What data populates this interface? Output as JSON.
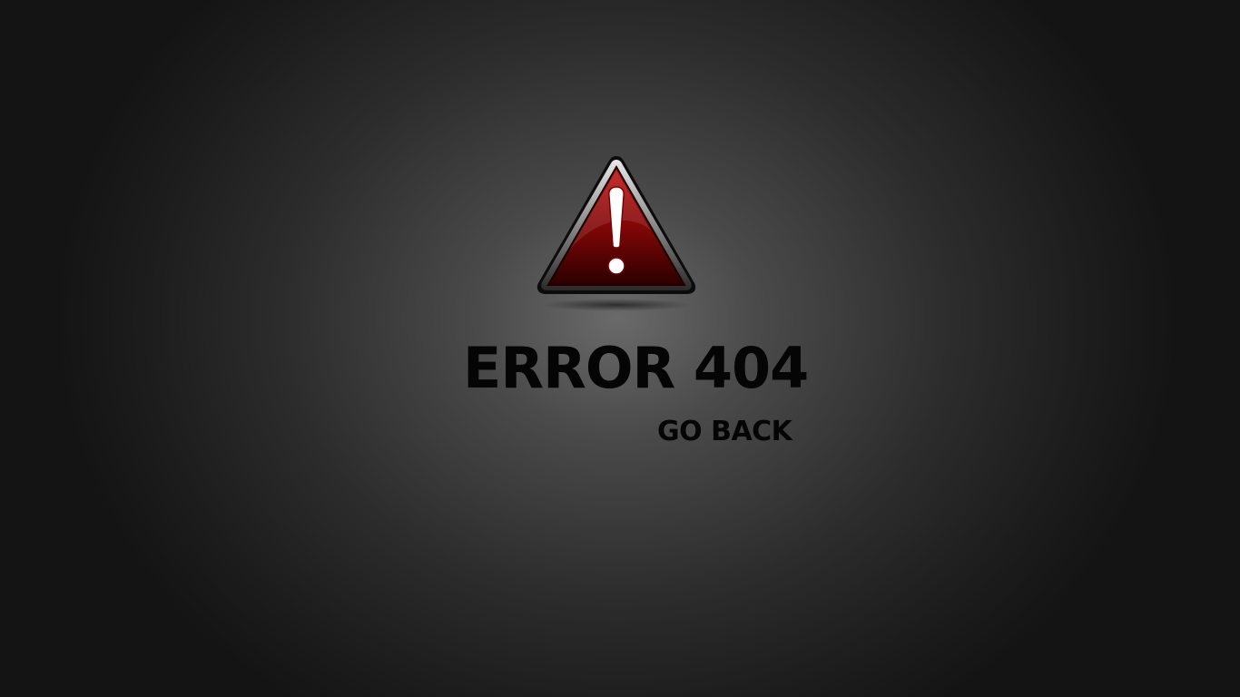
{
  "error": {
    "title": "ERROR 404",
    "icon": "warning-triangle-icon",
    "icon_color": "#9a0a0a"
  },
  "actions": {
    "go_back_label": "GO BACK"
  },
  "colors": {
    "background_center": "#6a6a6a",
    "background_edge": "#141414",
    "text": "#050505"
  }
}
